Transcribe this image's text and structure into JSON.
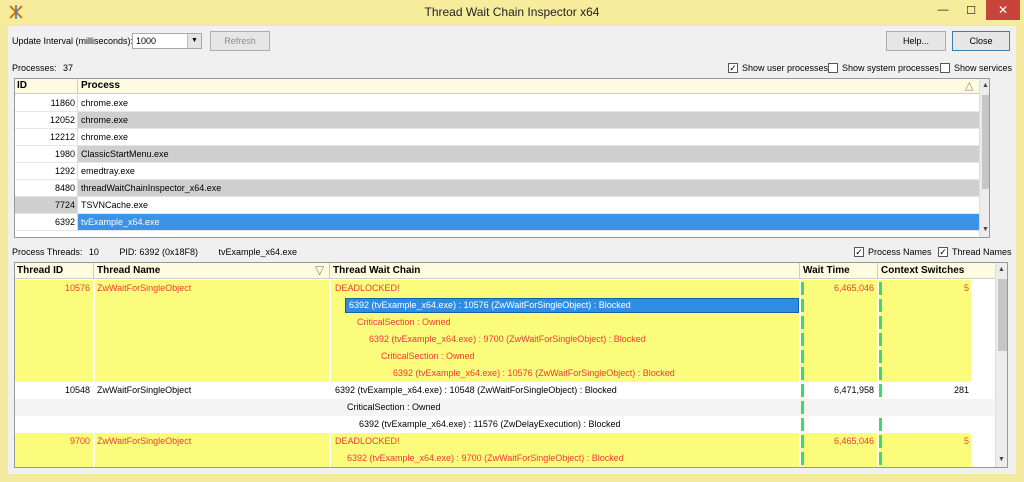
{
  "window": {
    "title": "Thread Wait Chain Inspector x64",
    "minimize_glyph": "—",
    "maximize_glyph": "☐",
    "close_glyph": "✕"
  },
  "controls": {
    "update_interval_label": "Update Interval (milliseconds):",
    "update_interval_value": "1000",
    "refresh_label": "Refresh",
    "help_label": "Help...",
    "close_label": "Close"
  },
  "processes": {
    "count_label": "Processes:",
    "count": "37",
    "show_user": {
      "label": "Show user processes",
      "checked": true
    },
    "show_system": {
      "label": "Show system processes",
      "checked": false
    },
    "show_services": {
      "label": "Show services",
      "checked": false
    },
    "columns": [
      "ID",
      "Process"
    ],
    "rows": [
      {
        "id": "11860",
        "name": "chrome.exe"
      },
      {
        "id": "12052",
        "name": "chrome.exe"
      },
      {
        "id": "12212",
        "name": "chrome.exe"
      },
      {
        "id": "1980",
        "name": "ClassicStartMenu.exe"
      },
      {
        "id": "1292",
        "name": "emedtray.exe"
      },
      {
        "id": "8480",
        "name": "threadWaitChainInspector_x64.exe"
      },
      {
        "id": "7724",
        "name": "TSVNCache.exe"
      },
      {
        "id": "6392",
        "name": "tvExample_x64.exe"
      }
    ]
  },
  "threads": {
    "count_label": "Process Threads:",
    "count": "10",
    "pid_label": "PID: 6392 (0x18F8)",
    "process_name": "tvExample_x64.exe",
    "process_names": {
      "label": "Process Names",
      "checked": true
    },
    "thread_names": {
      "label": "Thread Names",
      "checked": true
    },
    "columns": {
      "id": "Thread ID",
      "name": "Thread Name",
      "chain": "Thread Wait Chain",
      "wait": "Wait Time",
      "ctx": "Context Switches"
    },
    "rows": [
      {
        "id": "10576",
        "name": "ZwWaitForSingleObject",
        "chain": "DEADLOCKED!",
        "wait": "6,465,046",
        "ctx": "5"
      },
      {
        "id": "",
        "name": "",
        "chain": "6392 (tvExample_x64.exe) : 10576 (ZwWaitForSingleObject) : Blocked",
        "wait": "",
        "ctx": ""
      },
      {
        "id": "",
        "name": "",
        "chain": "CriticalSection : Owned",
        "wait": "",
        "ctx": ""
      },
      {
        "id": "",
        "name": "",
        "chain": "6392 (tvExample_x64.exe) : 9700 (ZwWaitForSingleObject) : Blocked",
        "wait": "",
        "ctx": ""
      },
      {
        "id": "",
        "name": "",
        "chain": "CriticalSection : Owned",
        "wait": "",
        "ctx": ""
      },
      {
        "id": "",
        "name": "",
        "chain": "6392 (tvExample_x64.exe) : 10576 (ZwWaitForSingleObject) : Blocked",
        "wait": "",
        "ctx": ""
      },
      {
        "id": "10548",
        "name": "ZwWaitForSingleObject",
        "chain": "6392 (tvExample_x64.exe) : 10548 (ZwWaitForSingleObject) : Blocked",
        "wait": "6,471,958",
        "ctx": "281"
      },
      {
        "id": "",
        "name": "",
        "chain": "CriticalSection : Owned",
        "wait": "",
        "ctx": ""
      },
      {
        "id": "",
        "name": "",
        "chain": "6392 (tvExample_x64.exe) : 11576 (ZwDelayExecution) : Blocked",
        "wait": "",
        "ctx": ""
      },
      {
        "id": "9700",
        "name": "ZwWaitForSingleObject",
        "chain": "DEADLOCKED!",
        "wait": "6,465,046",
        "ctx": "5"
      },
      {
        "id": "",
        "name": "",
        "chain": "6392 (tvExample_x64.exe) : 9700 (ZwWaitForSingleObject) : Blocked",
        "wait": "",
        "ctx": ""
      }
    ]
  },
  "colors": {
    "title_bar": "#f6ec9c",
    "deadlock_highlight": "#fcfc7c",
    "deadlock_text": "#ec3b3b",
    "selection": "#3a93e8",
    "activity_bar": "#43d66a"
  }
}
